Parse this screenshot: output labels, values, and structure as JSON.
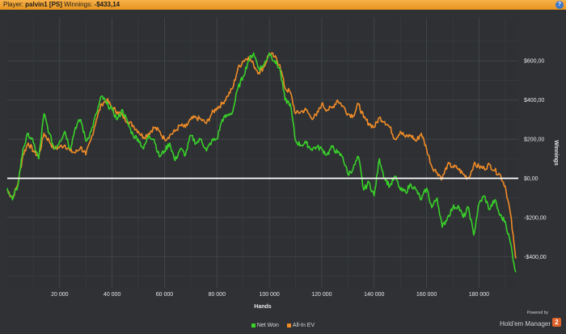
{
  "window": {
    "player_label": "Player:",
    "player_name": "palvin1 [PS]",
    "winnings_label": "Winnings:",
    "winnings_value": "-$433,14",
    "help_glyph": "?"
  },
  "legend": {
    "net_won": "Net Won",
    "allin_ev": "All-In EV"
  },
  "brand": {
    "powered_by": "Powered by",
    "name": "Hold'em Manager",
    "version": "2"
  },
  "colors": {
    "net_won": "#39d12a",
    "allin_ev": "#f08c28",
    "zero_line": "#ffffff",
    "grid": "#46494d",
    "title_bar": "#f0a030",
    "help_icon": "#3c78c8",
    "badge": "#e0622b"
  },
  "chart_data": {
    "type": "line",
    "xlabel": "Hands",
    "ylabel": "Winnings",
    "xlim": [
      0,
      195000
    ],
    "ylim": [
      -560,
      820
    ],
    "x_ticks": [
      20000,
      40000,
      60000,
      80000,
      100000,
      120000,
      140000,
      160000,
      180000
    ],
    "x_tick_labels": [
      "20 000",
      "40 000",
      "60 000",
      "80 000",
      "100 000",
      "120 000",
      "140 000",
      "160 000",
      "180 000"
    ],
    "y_ticks": [
      600,
      400,
      200,
      0,
      -200,
      -400
    ],
    "y_tick_labels": [
      "$600,00",
      "$400,00",
      "$200,00",
      "$0,00",
      "-$200,00",
      "-$400,00"
    ],
    "grid": true,
    "legend_position": "bottom",
    "series": [
      {
        "name": "Net Won",
        "x": [
          0,
          2000,
          4000,
          6000,
          8000,
          10000,
          12000,
          14000,
          16000,
          18000,
          20000,
          22000,
          24000,
          26000,
          28000,
          30000,
          32000,
          34000,
          36000,
          38000,
          40000,
          42000,
          44000,
          46000,
          48000,
          50000,
          52000,
          54000,
          56000,
          58000,
          60000,
          62000,
          64000,
          66000,
          68000,
          70000,
          72000,
          74000,
          76000,
          78000,
          80000,
          82000,
          84000,
          86000,
          88000,
          90000,
          92000,
          94000,
          96000,
          98000,
          100000,
          102000,
          104000,
          106000,
          108000,
          110000,
          112000,
          114000,
          116000,
          118000,
          120000,
          122000,
          124000,
          126000,
          128000,
          130000,
          132000,
          134000,
          136000,
          138000,
          140000,
          142000,
          144000,
          146000,
          148000,
          150000,
          152000,
          154000,
          156000,
          158000,
          160000,
          162000,
          164000,
          166000,
          168000,
          170000,
          172000,
          174000,
          176000,
          178000,
          180000,
          182000,
          184000,
          186000,
          188000,
          190000,
          192000,
          194000
        ],
        "values": [
          -50,
          -110,
          -40,
          150,
          230,
          180,
          100,
          330,
          230,
          150,
          190,
          240,
          150,
          260,
          300,
          190,
          240,
          330,
          420,
          380,
          350,
          300,
          350,
          280,
          220,
          200,
          150,
          220,
          200,
          110,
          140,
          180,
          90,
          150,
          120,
          220,
          180,
          200,
          140,
          190,
          200,
          300,
          320,
          340,
          460,
          520,
          600,
          640,
          560,
          580,
          640,
          600,
          560,
          400,
          380,
          190,
          170,
          180,
          150,
          160,
          150,
          120,
          160,
          130,
          110,
          20,
          50,
          110,
          -60,
          -20,
          -90,
          100,
          0,
          -40,
          10,
          -60,
          -70,
          -30,
          -60,
          -110,
          -50,
          -150,
          -100,
          -250,
          -200,
          -150,
          -140,
          -200,
          -150,
          -290,
          -130,
          -90,
          -160,
          -110,
          -190,
          -220,
          -330,
          -480
        ]
      },
      {
        "name": "All-In EV",
        "x": [
          0,
          2000,
          4000,
          6000,
          8000,
          10000,
          12000,
          14000,
          16000,
          18000,
          20000,
          22000,
          24000,
          26000,
          28000,
          30000,
          32000,
          34000,
          36000,
          38000,
          40000,
          42000,
          44000,
          46000,
          48000,
          50000,
          52000,
          54000,
          56000,
          58000,
          60000,
          62000,
          64000,
          66000,
          68000,
          70000,
          72000,
          74000,
          76000,
          78000,
          80000,
          82000,
          84000,
          86000,
          88000,
          90000,
          92000,
          94000,
          96000,
          98000,
          100000,
          102000,
          104000,
          106000,
          108000,
          110000,
          112000,
          114000,
          116000,
          118000,
          120000,
          122000,
          124000,
          126000,
          128000,
          130000,
          132000,
          134000,
          136000,
          138000,
          140000,
          142000,
          144000,
          146000,
          148000,
          150000,
          152000,
          154000,
          156000,
          158000,
          160000,
          162000,
          164000,
          166000,
          168000,
          170000,
          172000,
          174000,
          176000,
          178000,
          180000,
          182000,
          184000,
          186000,
          188000,
          190000,
          192000,
          194000
        ],
        "values": [
          -60,
          -100,
          -30,
          120,
          180,
          140,
          110,
          230,
          190,
          150,
          160,
          170,
          140,
          130,
          160,
          120,
          200,
          300,
          380,
          400,
          360,
          340,
          320,
          290,
          270,
          240,
          210,
          230,
          260,
          240,
          200,
          220,
          240,
          270,
          260,
          300,
          310,
          300,
          280,
          330,
          360,
          380,
          420,
          460,
          560,
          600,
          620,
          580,
          540,
          570,
          640,
          620,
          580,
          460,
          440,
          330,
          340,
          350,
          310,
          320,
          380,
          350,
          360,
          400,
          370,
          330,
          320,
          380,
          310,
          280,
          260,
          310,
          290,
          260,
          200,
          240,
          210,
          220,
          190,
          230,
          150,
          60,
          30,
          0,
          70,
          60,
          50,
          20,
          0,
          70,
          60,
          50,
          70,
          40,
          20,
          -40,
          -180,
          -410
        ]
      }
    ]
  }
}
